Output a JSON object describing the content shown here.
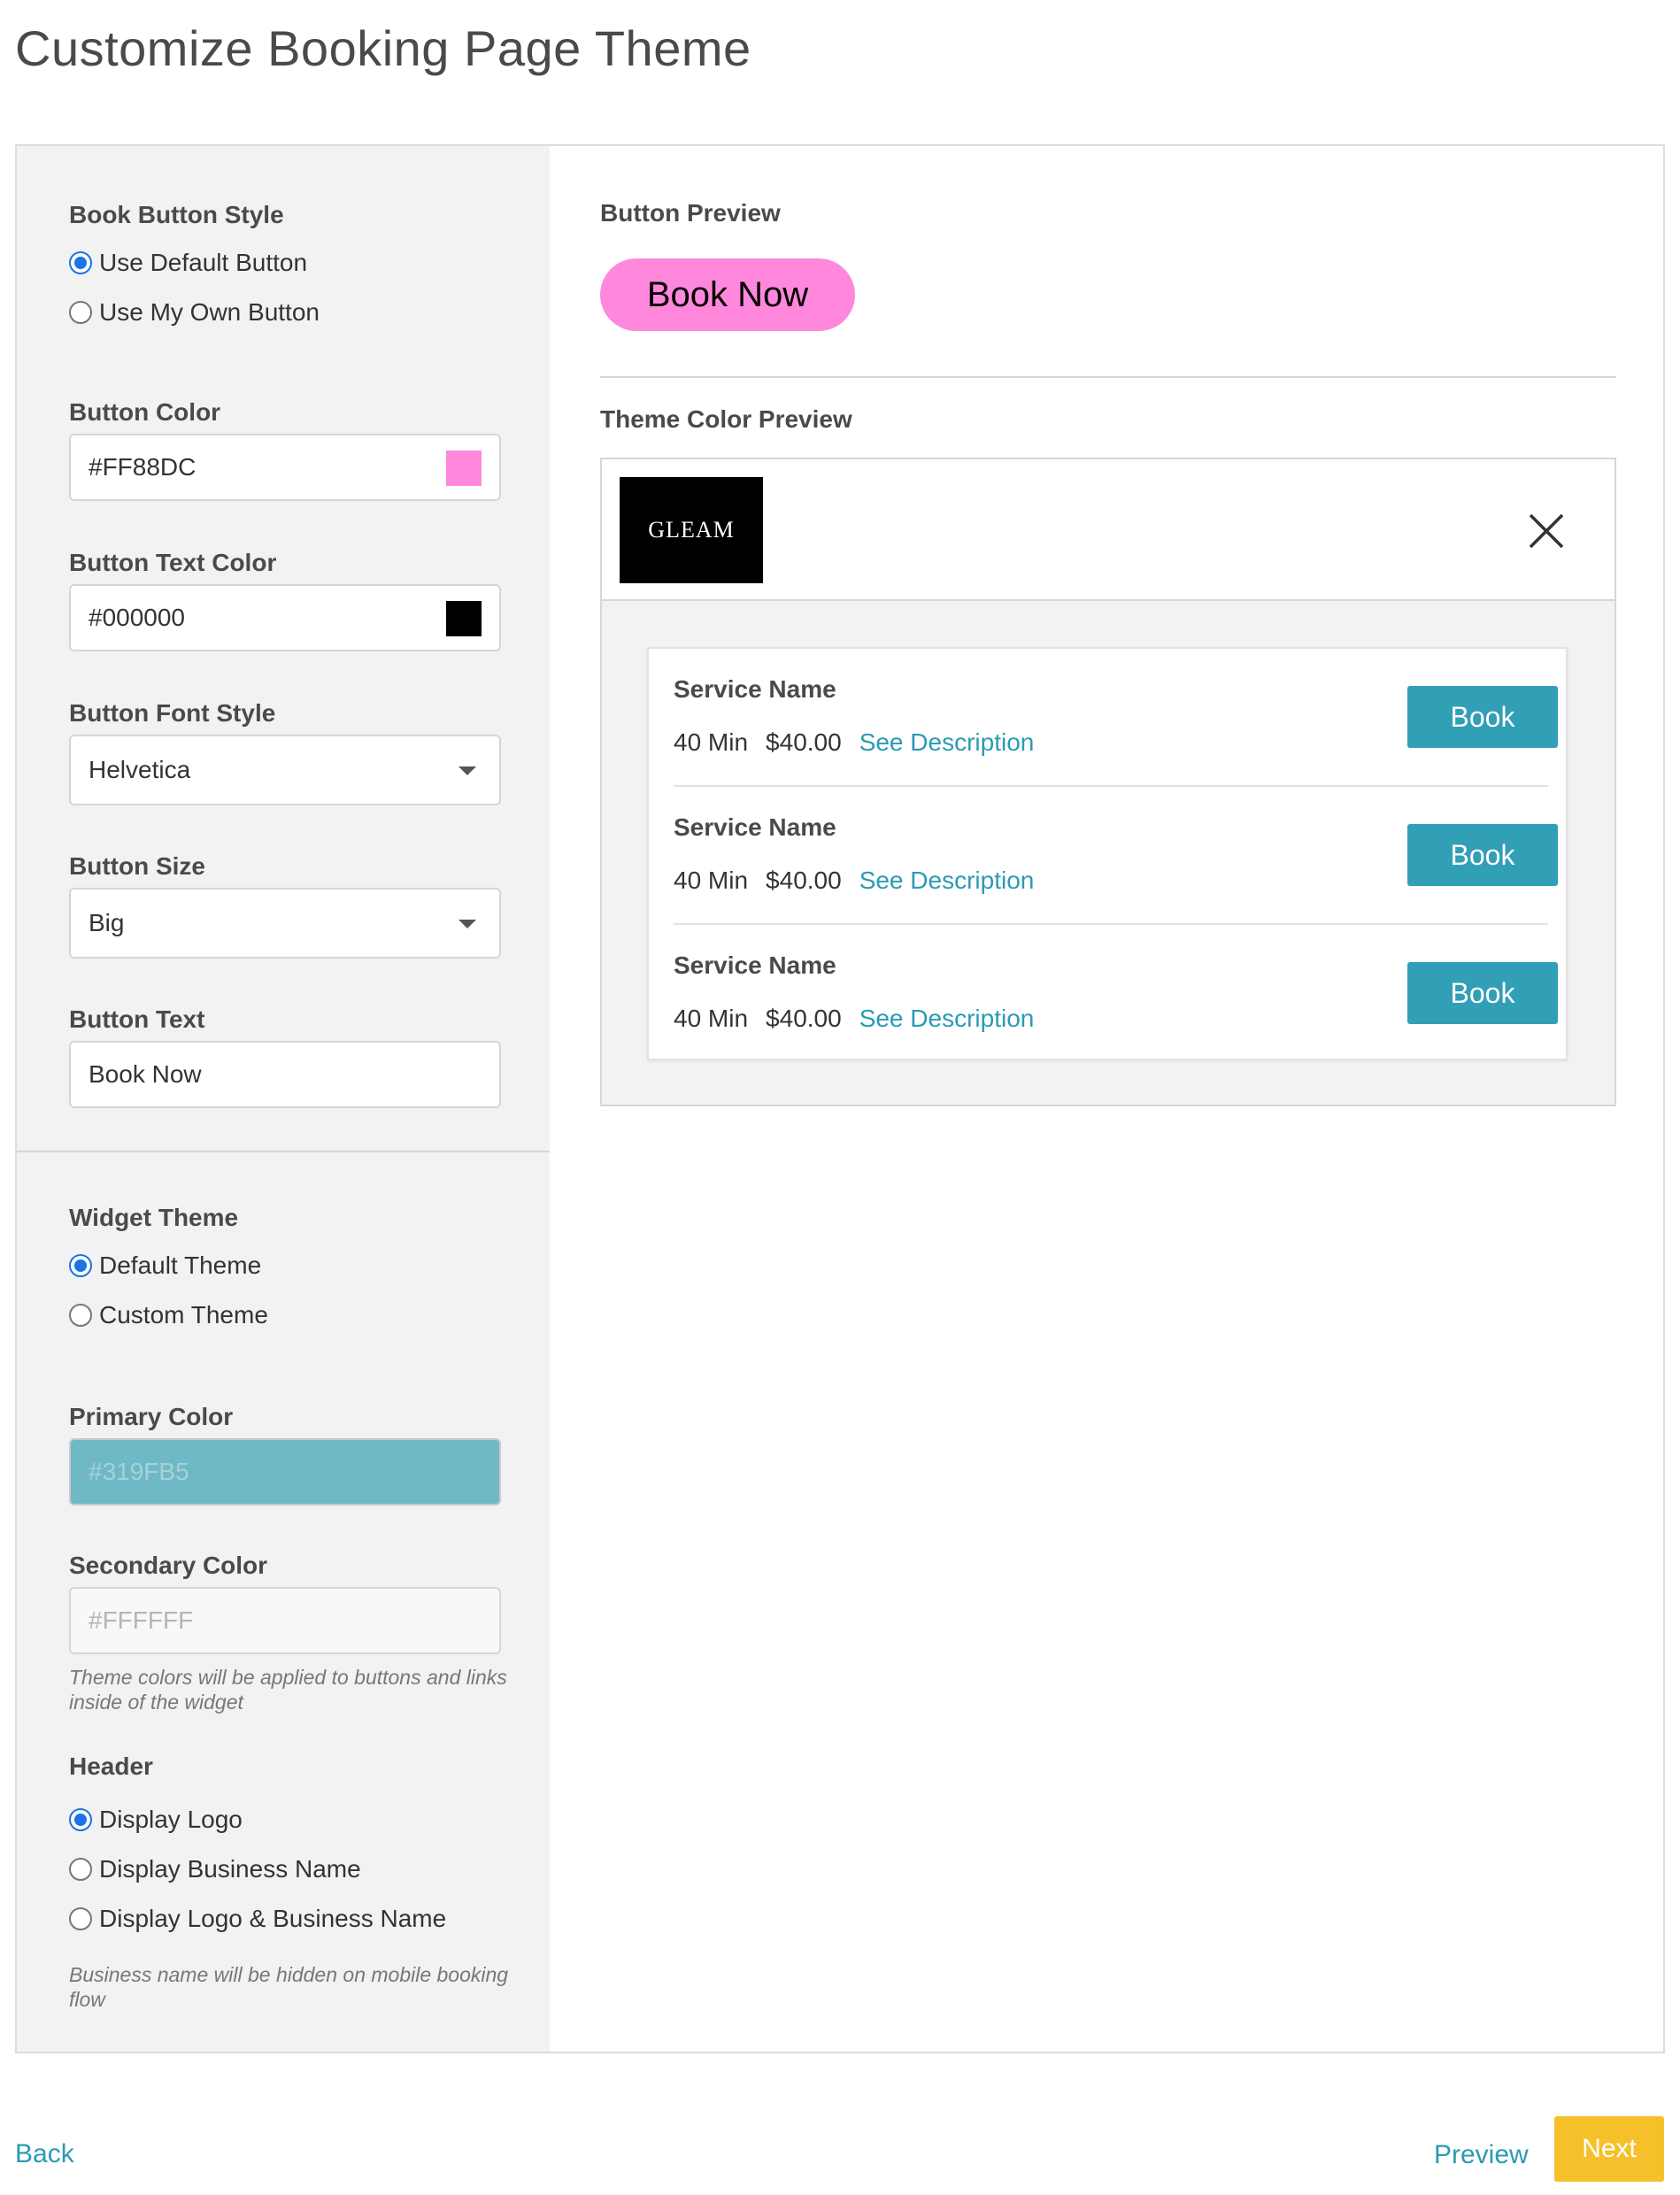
{
  "page": {
    "title": "Customize Booking Page Theme"
  },
  "left": {
    "book_button_style": {
      "label": "Book Button Style",
      "options": [
        "Use Default Button",
        "Use My Own Button"
      ],
      "selected": "Use Default Button"
    },
    "button_color": {
      "label": "Button Color",
      "value": "#FF88DC"
    },
    "button_text_color": {
      "label": "Button Text Color",
      "value": "#000000"
    },
    "button_font_style": {
      "label": "Button Font Style",
      "value": "Helvetica"
    },
    "button_size": {
      "label": "Button Size",
      "value": "Big"
    },
    "button_text": {
      "label": "Button Text",
      "value": "Book Now"
    },
    "widget_theme": {
      "label": "Widget Theme",
      "options": [
        "Default Theme",
        "Custom Theme"
      ],
      "selected": "Default Theme"
    },
    "primary_color": {
      "label": "Primary Color",
      "value": "#319FB5"
    },
    "secondary_color": {
      "label": "Secondary Color",
      "value": "#FFFFFF"
    },
    "theme_help": "Theme colors will be applied to buttons and links inside of the widget",
    "header": {
      "label": "Header",
      "options": [
        "Display Logo",
        "Display Business Name",
        "Display Logo & Business Name"
      ],
      "selected": "Display Logo"
    },
    "header_help": "Business name will be hidden on mobile booking flow"
  },
  "right": {
    "button_preview_label": "Button Preview",
    "preview_button_text": "Book Now",
    "theme_preview_label": "Theme Color Preview",
    "logo_text": "GLEAM",
    "services": [
      {
        "name": "Service Name",
        "duration": "40 Min",
        "price": "$40.00",
        "link": "See Description",
        "button": "Book"
      },
      {
        "name": "Service Name",
        "duration": "40 Min",
        "price": "$40.00",
        "link": "See Description",
        "button": "Book"
      },
      {
        "name": "Service Name",
        "duration": "40 Min",
        "price": "$40.00",
        "link": "See Description",
        "button": "Book"
      }
    ]
  },
  "footer": {
    "back": "Back",
    "preview": "Preview",
    "next": "Next"
  },
  "colors": {
    "accent": "#319FB5",
    "link": "#2a9bb3",
    "next": "#F6C02B",
    "button_preview": "#FF88DC",
    "radio_selected": "#1a73e8"
  }
}
